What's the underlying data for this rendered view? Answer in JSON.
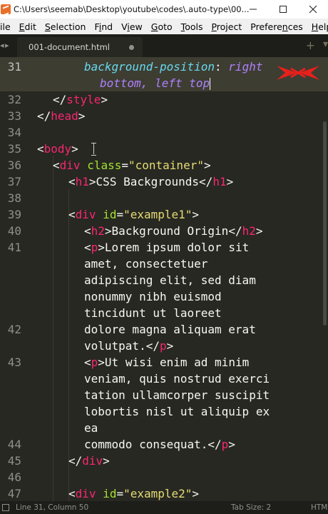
{
  "window": {
    "title": "C:\\Users\\seemab\\Desktop\\youtube\\codes\\.auto-type\\00..."
  },
  "menu": [
    {
      "ul": "F",
      "rest": "ile",
      "full": "File",
      "visible": "ile"
    },
    {
      "ul": "E",
      "rest": "dit"
    },
    {
      "ul": "S",
      "rest": "election"
    },
    {
      "ul": "F",
      "rest": "ind",
      "ul_idx": 1
    },
    {
      "ul": "V",
      "rest": "iew",
      "ul_idx": 1
    },
    {
      "ul": "G",
      "rest": "oto"
    },
    {
      "ul": "T",
      "rest": "ools"
    },
    {
      "ul": "P",
      "rest": "roject"
    },
    {
      "ul": "n",
      "rest": "Prefere",
      "after": "ces"
    },
    {
      "ul": "H",
      "rest": "elp"
    }
  ],
  "menu_labels": [
    "ile",
    "Edit",
    "Selection",
    "Find",
    "View",
    "Goto",
    "Tools",
    "Project",
    "Preferences",
    "Help"
  ],
  "tabs": {
    "nav": "◂ ▸",
    "active": "001-document.html",
    "plus": "+",
    "more": "▾"
  },
  "editor": {
    "current_line": "31",
    "line_numbers": [
      "31",
      "32",
      "33",
      "34",
      "35",
      "36",
      "37",
      "38",
      "39",
      "40",
      "41",
      "42",
      "43",
      "44",
      "45",
      "46",
      "47"
    ],
    "code": {
      "l31a_prop": "background-position",
      "l31a_colon": ": ",
      "l31a_val": "right",
      "l31b_val": "bottom, left top",
      "l32_open": "</",
      "l32_tag": "style",
      "l32_close": ">",
      "l33_open": "</",
      "l33_tag": "head",
      "l33_close": ">",
      "l35_open": "<",
      "l35_tag": "body",
      "l35_close": ">",
      "l36_open": "<",
      "l36_tag": "div",
      "l36_attr": "class",
      "l36_eq": "=",
      "l36_str": "\"container\"",
      "l36_close": ">",
      "l37_open": "<",
      "l37_tag": "h1",
      "l37_close": ">",
      "l37_text": "CSS Backgrounds",
      "l37_eopen": "</",
      "l37_etag": "h1",
      "l37_eclose": ">",
      "l39_open": "<",
      "l39_tag": "div",
      "l39_attr": "id",
      "l39_eq": "=",
      "l39_str": "\"example1\"",
      "l39_close": ">",
      "l40_open": "<",
      "l40_tag": "h2",
      "l40_close": ">",
      "l40_text": "Background Origin",
      "l40_eopen": "</",
      "l40_etag": "h2",
      "l40_eclose": ">",
      "l41_open": "<",
      "l41_tag": "p",
      "l41_close": ">",
      "l41_text1": "Lorem ipsum dolor sit",
      "l41_text2": "amet, consectetuer",
      "l41_text3": "adipiscing elit, sed diam",
      "l41_text4": "nonummy nibh euismod",
      "l41_text5": "tincidunt ut laoreet",
      "l42_text1": "dolore magna aliquam erat",
      "l42_text2": "volutpat.",
      "l42_eopen": "</",
      "l42_etag": "p",
      "l42_eclose": ">",
      "l43_open": "<",
      "l43_tag": "p",
      "l43_close": ">",
      "l43_text1": "Ut wisi enim ad minim",
      "l43_text2": "veniam, quis nostrud exerci",
      "l43_text3": "tation ullamcorper suscipit",
      "l43_text4": "lobortis nisl ut aliquip ex",
      "l43_text5": "ea",
      "l44_text": "commodo consequat.",
      "l44_eopen": "</",
      "l44_etag": "p",
      "l44_eclose": ">",
      "l45_open": "</",
      "l45_tag": "div",
      "l45_close": ">",
      "l47_open": "<",
      "l47_tag": "div",
      "l47_attr": "id",
      "l47_eq": "=",
      "l47_str": "\"example2\"",
      "l47_close": ">"
    }
  },
  "status": {
    "position": "Line 31, Column 50",
    "tab_size": "Tab Size: 2",
    "syntax": "HTM"
  },
  "colors": {
    "background": "#272822",
    "tag": "#f92672",
    "attribute": "#a6e22e",
    "string": "#e6db74",
    "keyword": "#66d9ef",
    "value": "#ae81ff",
    "logo": "#e8201c"
  }
}
